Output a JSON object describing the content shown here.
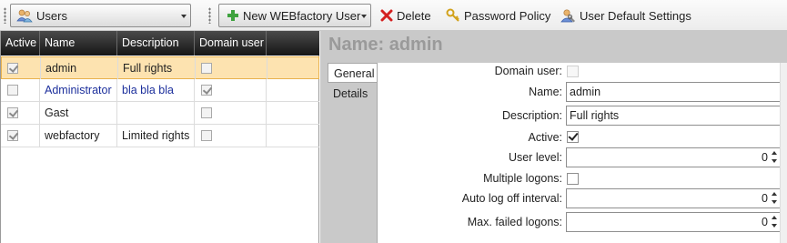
{
  "toolbar": {
    "module_select": "Users",
    "new_user_label": "New WEBfactory User",
    "delete_label": "Delete",
    "password_policy_label": "Password Policy",
    "user_default_settings_label": "User Default Settings"
  },
  "grid": {
    "columns": [
      "Active",
      "Name",
      "Description",
      "Domain user"
    ],
    "rows": [
      {
        "active": true,
        "name": "admin",
        "description": "Full rights",
        "domain_user": false,
        "selected": true
      },
      {
        "active": false,
        "name": "Administrator",
        "description": "bla bla bla",
        "domain_user": true,
        "selected": false
      },
      {
        "active": true,
        "name": "Gast",
        "description": "",
        "domain_user": false,
        "selected": false
      },
      {
        "active": true,
        "name": "webfactory",
        "description": "Limited rights",
        "domain_user": false,
        "selected": false
      }
    ]
  },
  "detail": {
    "title": "Name: admin",
    "tabs": [
      "General",
      "Details"
    ],
    "fields": {
      "domain_user_label": "Domain user:",
      "name_label": "Name:",
      "name_value": "admin",
      "description_label": "Description:",
      "description_value": "Full rights",
      "active_label": "Active:",
      "user_level_label": "User level:",
      "user_level_value": "0",
      "multiple_logons_label": "Multiple logons:",
      "auto_logoff_label": "Auto log off interval:",
      "auto_logoff_value": "0",
      "max_failed_label": "Max. failed logons:",
      "max_failed_value": "0"
    }
  },
  "colors": {
    "selected_row": "#fde3b0",
    "header_dark": "#161616",
    "link_blue": "#1c2f9c"
  }
}
